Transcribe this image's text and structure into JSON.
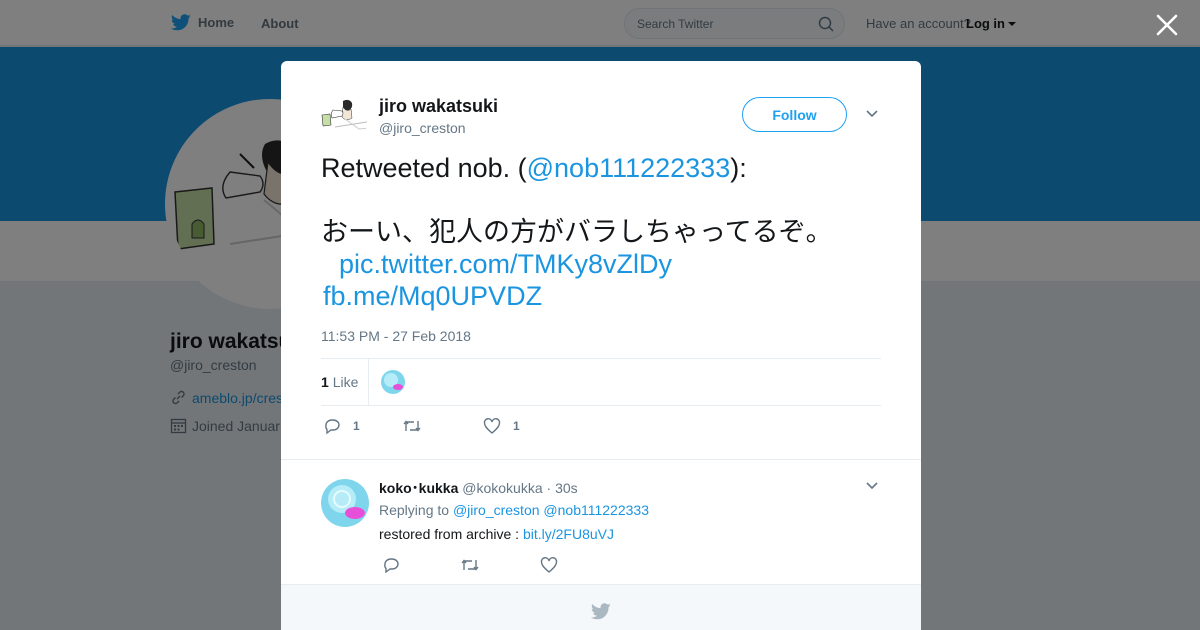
{
  "topbar": {
    "home_label": "Home",
    "about_label": "About",
    "search_placeholder": "Search Twitter",
    "account_prompt": "Have an account?",
    "login_label": "Log in"
  },
  "profile": {
    "name": "jiro wakatsuki",
    "handle": "@jiro_creston",
    "link": "ameblo.jp/cres",
    "joined": "Joined Januar"
  },
  "tweet": {
    "author_name": "jiro wakatsuki",
    "author_handle": "@jiro_creston",
    "follow_label": "Follow",
    "text": {
      "prefix": "Retweeted nob. (",
      "mention": "@nob111222333",
      "suffix": "):",
      "body": "おーい、犯人の方がバラしちゃってるぞ。",
      "link1": "pic.twitter.com/TMKy8vZlDy",
      "link2": "fb.me/Mq0UPVDZ"
    },
    "timestamp": "11:53 PM - 27 Feb 2018",
    "likes_count": "1",
    "likes_label": "Like",
    "actions": {
      "reply_count": "1",
      "retweet_count": "",
      "like_count": "1"
    }
  },
  "reply": {
    "name": "koko･kukka",
    "handle": "@kokokukka",
    "time": "· 30s",
    "replying_prefix": "Replying to",
    "mention1": "@jiro_creston",
    "mention2": "@nob111222333",
    "text": "restored from archive :",
    "link": "bit.ly/2FU8uVJ"
  },
  "colors": {
    "accent": "#1da1f2",
    "link": "#1b95e0",
    "banner": "#1b95e0",
    "muted": "#657786"
  },
  "icons": [
    "twitter-bird-icon",
    "search-icon",
    "close-icon",
    "chevron-down-icon",
    "link-icon",
    "calendar-icon",
    "reply-icon",
    "retweet-icon",
    "heart-icon"
  ]
}
